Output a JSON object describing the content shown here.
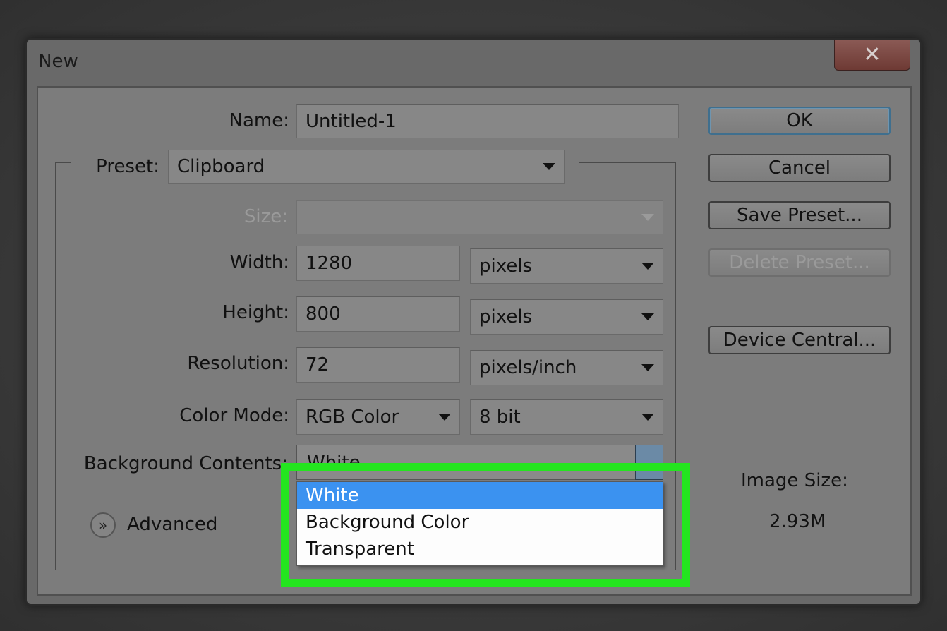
{
  "window": {
    "title": "New",
    "close_glyph": "✕"
  },
  "form": {
    "name_label": "Name:",
    "name_value": "Untitled-1",
    "preset_label": "Preset:",
    "preset_value": "Clipboard",
    "size_label": "Size:",
    "size_value": "",
    "width_label": "Width:",
    "width_value": "1280",
    "width_unit": "pixels",
    "height_label": "Height:",
    "height_value": "800",
    "height_unit": "pixels",
    "resolution_label": "Resolution:",
    "resolution_value": "72",
    "resolution_unit": "pixels/inch",
    "color_mode_label": "Color Mode:",
    "color_mode_value": "RGB Color",
    "bit_depth_value": "8 bit",
    "background_label": "Background Contents:",
    "background_value": "White",
    "advanced_label": "Advanced"
  },
  "buttons": {
    "ok": "OK",
    "cancel": "Cancel",
    "save_preset": "Save Preset...",
    "delete_preset": "Delete Preset...",
    "device_central": "Device Central..."
  },
  "image_size": {
    "label": "Image Size:",
    "value": "2.93M"
  },
  "dropdown": {
    "items": [
      "White",
      "Background Color",
      "Transparent"
    ],
    "selected": "White"
  },
  "colors": {
    "highlight": "#24e51f",
    "selection": "#3b92f0",
    "default_button_border": "#3f6f8e"
  }
}
